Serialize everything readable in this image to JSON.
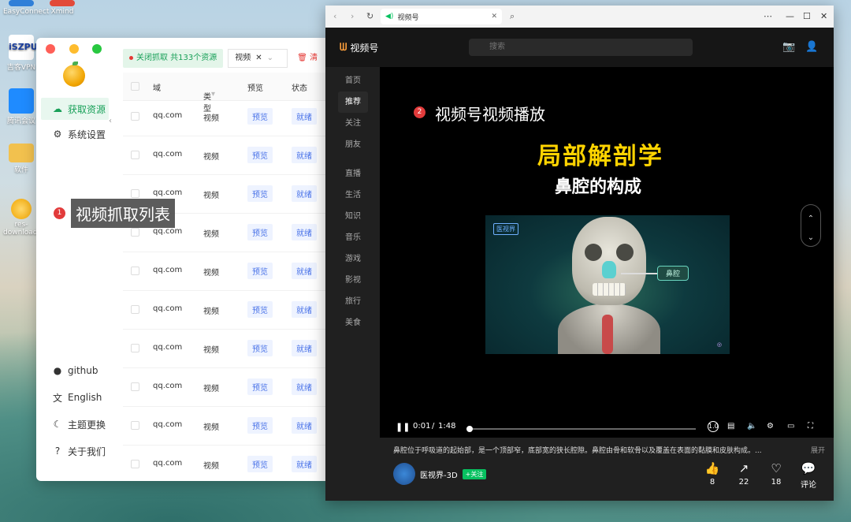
{
  "desktop": {
    "icons": [
      {
        "label": "EasyConnect",
        "color": "#2f7fd8"
      },
      {
        "label": "Xmind",
        "color": "#e24a3a"
      },
      {
        "label": "吉客VPN",
        "color": "#ffffff"
      },
      {
        "label": "腾讯会议",
        "color": "#1f8bff"
      },
      {
        "label": "软件",
        "color": "#f2c14e"
      },
      {
        "label": "res-downloader",
        "color": "#f0a400"
      }
    ]
  },
  "app": {
    "nav": [
      {
        "label": "获取资源",
        "icon": "cloud-icon",
        "active": true
      },
      {
        "label": "系统设置",
        "icon": "gear-icon",
        "active": false
      }
    ],
    "bottom_nav": [
      {
        "label": "github",
        "icon": "github-icon"
      },
      {
        "label": "English",
        "icon": "translate-icon"
      },
      {
        "label": "主题更换",
        "icon": "moon-icon"
      },
      {
        "label": "关于我们",
        "icon": "help-icon"
      }
    ],
    "toolbar": {
      "capture_status": "关闭抓取 共133个资源",
      "filter_value": "视频",
      "clear_label": "清"
    },
    "columns": [
      "域",
      "类型",
      "预览",
      "状态"
    ],
    "rows": [
      {
        "domain": "qq.com",
        "type": "视频",
        "preview": "预览",
        "status": "就绪"
      },
      {
        "domain": "qq.com",
        "type": "视频",
        "preview": "预览",
        "status": "就绪"
      },
      {
        "domain": "qq.com",
        "type": "视频",
        "preview": "预览",
        "status": "就绪"
      },
      {
        "domain": "qq.com",
        "type": "视频",
        "preview": "预览",
        "status": "就绪"
      },
      {
        "domain": "qq.com",
        "type": "视频",
        "preview": "预览",
        "status": "就绪"
      },
      {
        "domain": "qq.com",
        "type": "视频",
        "preview": "预览",
        "status": "就绪"
      },
      {
        "domain": "qq.com",
        "type": "视频",
        "preview": "预览",
        "status": "就绪"
      },
      {
        "domain": "qq.com",
        "type": "视频",
        "preview": "预览",
        "status": "就绪"
      },
      {
        "domain": "qq.com",
        "type": "视频",
        "preview": "预览",
        "status": "就绪"
      },
      {
        "domain": "qq.com",
        "type": "视频",
        "preview": "预览",
        "status": "就绪"
      }
    ],
    "callout": {
      "number": "1",
      "text": "视频抓取列表"
    }
  },
  "browser": {
    "tab_title": "视频号",
    "brand": "视频号",
    "search_placeholder": "搜索",
    "nav": [
      "首页",
      "推荐",
      "关注",
      "朋友",
      "直播",
      "生活",
      "知识",
      "音乐",
      "游戏",
      "影视",
      "旅行",
      "美食"
    ],
    "active_nav": "推荐",
    "video": {
      "callout_number": "2",
      "callout_text": "视频号视频播放",
      "headline": "局部解剖学",
      "subheadline": "鼻腔的构成",
      "label": "鼻腔",
      "current_time": "0:01",
      "duration": "1:48",
      "progress": 0.01,
      "speed_label": "1.0"
    },
    "description": "鼻腔位于呼吸道的起始部，是一个顶部窄，底部宽的狭长腔隙。鼻腔由骨和软骨以及覆盖在表面的黏膜和皮肤构成。...",
    "more_label": "展开",
    "author": {
      "name": "医视界-3D",
      "follow_label": "+关注"
    },
    "actions": [
      {
        "icon": "like-icon",
        "count": "8"
      },
      {
        "icon": "share-icon",
        "count": "22"
      },
      {
        "icon": "heart-icon",
        "count": "18"
      },
      {
        "icon": "comment-icon",
        "count": "评论"
      }
    ]
  }
}
